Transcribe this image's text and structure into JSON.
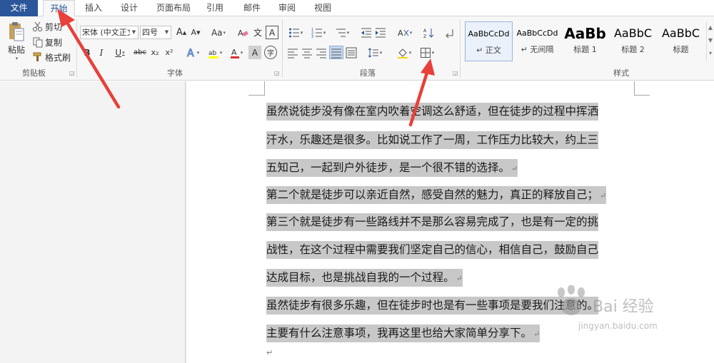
{
  "tabs": {
    "file": "文件",
    "home": "开始",
    "insert": "插入",
    "design": "设计",
    "layout": "页面布局",
    "references": "引用",
    "mailings": "邮件",
    "review": "审阅",
    "view": "视图"
  },
  "clipboard": {
    "paste": "粘贴",
    "cut": "剪切",
    "copy": "复制",
    "format_painter": "格式刷",
    "group_label": "剪贴板"
  },
  "font": {
    "font_name": "宋体 (中文正文",
    "font_size": "四号",
    "group_label": "字体",
    "bold": "B",
    "italic": "I",
    "underline": "U",
    "strike": "abc",
    "subscript": "x₂",
    "superscript": "x²",
    "grow": "A",
    "shrink": "A",
    "case": "Aa",
    "char_border": "A",
    "enclose": "字",
    "phonetic": "文"
  },
  "paragraph": {
    "group_label": "段落"
  },
  "styles": {
    "group_label": "样式",
    "items": [
      {
        "sample": "AaBbCcDd",
        "name": "↵ 正文"
      },
      {
        "sample": "AaBbCcDd",
        "name": "↵ 无间隔"
      },
      {
        "sample": "AaBb",
        "name": "标题 1"
      },
      {
        "sample": "AaBbC",
        "name": "标题 2"
      },
      {
        "sample": "AaBbC",
        "name": "标题"
      }
    ]
  },
  "document": {
    "lines": [
      {
        "text": "虽然说徒步没有像在室内吹着空调这么舒适，但在徒步的过程中挥洒",
        "mark": ""
      },
      {
        "text": "汗水，乐趣还是很多。比如说工作了一周，工作压力比较大，约上三",
        "mark": ""
      },
      {
        "text": "五知己，一起到户外徒步，是一个很不错的选择。",
        "mark": "↵"
      },
      {
        "text": "第二个就是徒步可以亲近自然，感受自然的魅力，真正的释放自己；",
        "mark": "↵"
      },
      {
        "text": "第三个就是徒步有一些路线并不是那么容易完成了，也是有一定的挑",
        "mark": ""
      },
      {
        "text": "战性，在这个过程中需要我们坚定自己的信心，相信自己，鼓励自己",
        "mark": ""
      },
      {
        "text": "达成目标，也是挑战自我的一个过程。",
        "mark": "↵"
      },
      {
        "text": "虽然徒步有很多乐趣，但在徒步时也是有一些事项是要我们注意的。",
        "mark": ""
      },
      {
        "text": "主要有什么注意事项，我再这里也给大家简单分享下。",
        "mark": "↵"
      }
    ],
    "end_mark": "↵"
  },
  "watermark": {
    "brand": "Bai 经验",
    "url": "jingyan.baidu.com"
  },
  "colors": {
    "file_tab": "#2b579a",
    "selection": "#c8c8c8",
    "arrow": "#e8403a"
  }
}
